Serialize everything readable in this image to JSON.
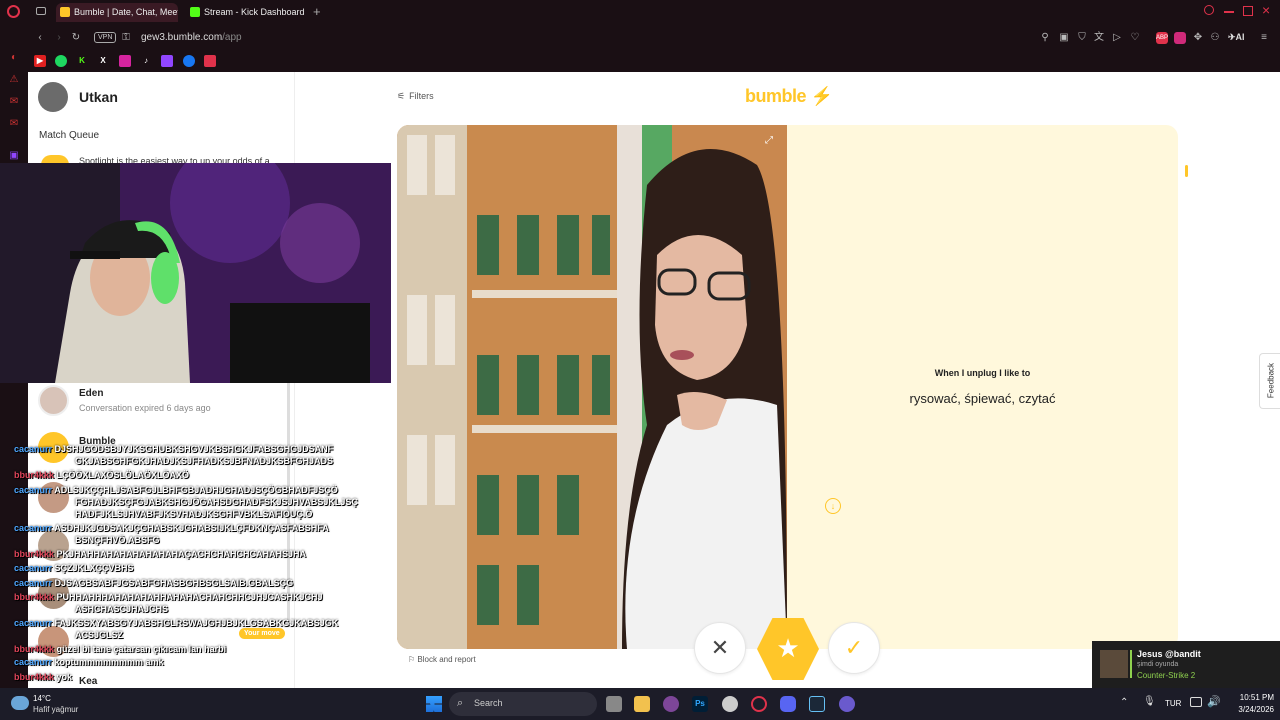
{
  "browser": {
    "tabs": [
      {
        "label": "Bumble | Date, Chat, Meet",
        "active": true
      },
      {
        "label": "Stream - Kick Dashboard",
        "active": false
      }
    ],
    "vpn_label": "VPN",
    "url_host": "gew3.bumble.com",
    "url_path": "/app",
    "ai_label": "AI"
  },
  "app": {
    "user_name": "Utkan",
    "match_queue_label": "Match Queue",
    "spotlight_text": "Spotlight is the easiest way to up your odds of a",
    "conversations": [
      {
        "name": "Eden",
        "status": "Conversation expired 6 days ago"
      },
      {
        "name": "Bumble",
        "status": ""
      },
      {
        "name": "Kea",
        "status": ""
      }
    ],
    "your_move_badge": "Your move",
    "filters_label": "Filters",
    "logo_text": "bumble",
    "prompt_question": "When I unplug I like to",
    "prompt_answer": "rysować, śpiewać, czytać",
    "block_report_label": "Block and report",
    "feedback_label": "Feedback",
    "brand_color": "#ffc629"
  },
  "chat": [
    {
      "user": "cacanurr",
      "msg": "DJSHJGODSBJYJKSGHUBKSHGVJKBSHGKJFABSGHGJDSANF",
      "color": "blue"
    },
    {
      "user": "",
      "msg": "GKJABSGHFGKJHADJKSJFHADKSJBFNADJKSBFGHJADS",
      "color": "blue"
    },
    {
      "user": "bbur4kkk",
      "msg": "LÇÖÖXLAXÖSLÖLAÖXLÖAXÖ",
      "color": "red"
    },
    {
      "user": "cacanurr",
      "msg": "ADLSJKÇÇHLJSABFGJLBHFGBJADHJGHADJSÇÖGBHADFJSÇÖ",
      "color": "blue"
    },
    {
      "user": "",
      "msg": "FGHADJKSÇFGJABKSHGJÖGAHSDGHADFSKJSJHVABSJKLJSÇ",
      "color": "blue"
    },
    {
      "user": "",
      "msg": "HADFJKLSJHVABFJKSVHADJKSGHFVBKLSAFIOUÇ.Ö",
      "color": "blue"
    },
    {
      "user": "cacanurr",
      "msg": "ASDHJKJGDSAKJÇGHABSKJGHABSIJKLÇFDKNÇASFABSHFA",
      "color": "blue"
    },
    {
      "user": "",
      "msg": "BSNÇFHVÖ.ABSFG",
      "color": "blue"
    },
    {
      "user": "bbur4kkk",
      "msg": "PKJHAHHAHAHAHAHAHAHAÇACHCHAHCHCAHAHSJHA",
      "color": "red"
    },
    {
      "user": "cacanurr",
      "msg": "SÇZJKLXÇÇVBHS",
      "color": "blue"
    },
    {
      "user": "cacanurr",
      "msg": "DJSAGBSABFJGSABFGHASBGHBSGLSAIB.GBALSÇG",
      "color": "blue"
    },
    {
      "user": "bbur4kkk",
      "msg": "PUHHAHHHAHAHAHAHHAHAHACHAHCHHCJHJCASHKJCHJ",
      "color": "red"
    },
    {
      "user": "",
      "msg": "ASHCHASCJHAJCHS",
      "color": "red"
    },
    {
      "user": "cacanurr",
      "msg": "FAJKSSXYABSGYJABSHGLRSWAJGHJBJKLGSABKGJKABSJGK",
      "color": "blue"
    },
    {
      "user": "",
      "msg": "ACSJGLSZ",
      "color": "blue"
    },
    {
      "user": "bbur4kkk",
      "msg": "güzel bi tane çatarsan çıkıcam lan harbi",
      "color": "red"
    },
    {
      "user": "cacanurr",
      "msg": "koptummmmmmmm amk",
      "color": "blue"
    },
    {
      "user": "bbur4kkk",
      "msg": "yok",
      "color": "red"
    }
  ],
  "notification": {
    "title": "Jesus @bandit",
    "subtitle": "şimdi oyunda",
    "game": "Counter-Strike 2"
  },
  "taskbar": {
    "weather_temp": "14°C",
    "weather_desc": "Hafif yağmur",
    "search_label": "Search",
    "lang": "TUR",
    "time": "10:51 PM",
    "date": "3/24/2026"
  }
}
